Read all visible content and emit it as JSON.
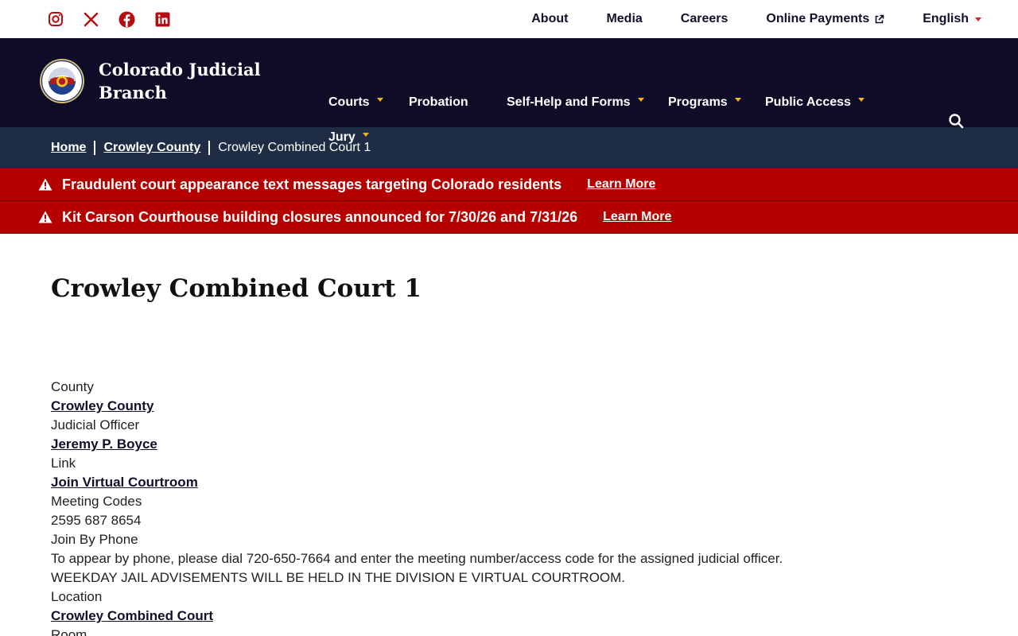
{
  "social": {
    "icons": [
      "instagram-icon",
      "x-icon",
      "facebook-icon",
      "linkedin-icon"
    ],
    "color": "#b50d12"
  },
  "utility_nav": {
    "about": "About",
    "media": "Media",
    "careers": "Careers",
    "online_payments": "Online Payments",
    "language": "English"
  },
  "brand": {
    "name": "Colorado Judicial Branch"
  },
  "main_nav": {
    "courts": "Courts",
    "probation": "Probation",
    "self_help": "Self-Help and Forms",
    "programs": "Programs",
    "public_access": "Public Access",
    "jury": "Jury"
  },
  "breadcrumb": {
    "home": "Home",
    "county": "Crowley County",
    "current": "Crowley Combined Court 1"
  },
  "alerts": [
    {
      "message": "Fraudulent court appearance text messages targeting Colorado residents",
      "link": "Learn More"
    },
    {
      "message": "Kit Carson Courthouse building closures announced for 7/30/26 and 7/31/26",
      "link": "Learn More"
    }
  ],
  "page": {
    "title": "Crowley Combined Court 1"
  },
  "details": {
    "county_label": "County",
    "county_value": "Crowley County",
    "officer_label": "Judicial Officer",
    "officer_value": "Jeremy P. Boyce",
    "link_label": "Link",
    "link_value": "Join Virtual Courtroom",
    "codes_label": "Meeting Codes",
    "codes_value": "2595 687 8654",
    "phone_label": "Join By Phone",
    "phone_text": "To appear by phone, please dial 720-650-7664 and enter the meeting number/access code for the assigned judicial officer.",
    "advisement_text": "WEEKDAY JAIL ADVISEMENTS WILL BE HELD IN THE DIVISION E VIRTUAL COURTROOM.",
    "location_label": "Location",
    "location_value": "Crowley Combined Court",
    "room_label": "Room"
  },
  "colors": {
    "navbar": "#0e0c27",
    "breadcrumb": "#1e2d44",
    "alert": "#b50000",
    "accent_yellow": "#f4b41a",
    "accent_red": "#d0242b"
  }
}
